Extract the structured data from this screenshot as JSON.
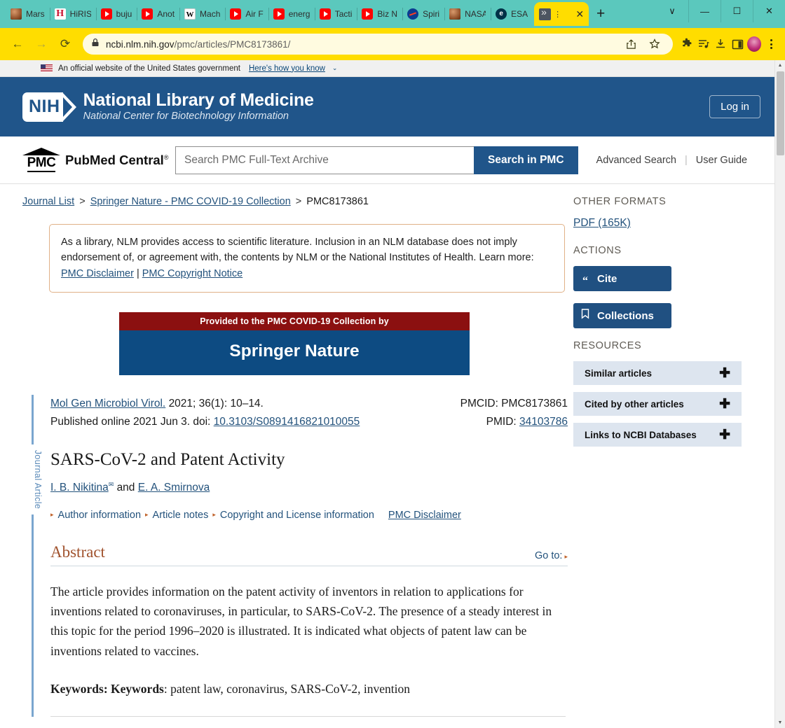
{
  "browser": {
    "bookmarks": [
      {
        "label": "Mars",
        "icon": "mars-favicon"
      },
      {
        "label": "HiRIS",
        "icon": "hirise-favicon"
      },
      {
        "label": "buju",
        "icon": "youtube-favicon"
      },
      {
        "label": "Anot",
        "icon": "youtube-favicon"
      },
      {
        "label": "Mach",
        "icon": "wikipedia-favicon"
      },
      {
        "label": "Air F",
        "icon": "youtube-favicon"
      },
      {
        "label": "energ",
        "icon": "youtube-favicon"
      },
      {
        "label": "Tacti",
        "icon": "youtube-favicon"
      },
      {
        "label": "Biz N",
        "icon": "youtube-favicon"
      },
      {
        "label": "Spiri",
        "icon": "nasa-favicon"
      },
      {
        "label": "NASA",
        "icon": "mars-favicon"
      },
      {
        "label": "ESA",
        "icon": "esa-favicon"
      }
    ],
    "tab": {
      "title": "",
      "menu_dots": "⋮",
      "close": "✕"
    },
    "new_tab_label": "+",
    "window_controls": {
      "dropdown": "∨",
      "minimize": "—",
      "maximize": "☐",
      "close": "✕"
    },
    "nav": {
      "back": "←",
      "forward": "→",
      "reload": "⟳"
    },
    "omnibox": {
      "url_domain": "ncbi.nlm.nih.gov",
      "url_path": "/pmc/articles/PMC8173861/",
      "lock": "lock-icon"
    },
    "toolbar_icons": [
      "share-icon",
      "star-icon",
      "extensions-icon",
      "reading-list-icon",
      "download-icon",
      "side-panel-icon",
      "profile-avatar",
      "chrome-menu-icon"
    ]
  },
  "gov_banner": {
    "text": "An official website of the United States government",
    "link": "Here's how you know",
    "chevron": "⌄"
  },
  "nih_header": {
    "badge": "NIH",
    "title": "National Library of Medicine",
    "subtitle": "National Center for Biotechnology Information",
    "login_label": "Log in"
  },
  "pmc_bar": {
    "logo_abbr": "PMC",
    "logo_name": "PubMed Central",
    "logo_reg": "®",
    "search_placeholder": "Search PMC Full-Text Archive",
    "search_value": "",
    "search_button": "Search in PMC",
    "advanced_search": "Advanced Search",
    "separator": "|",
    "user_guide": "User Guide"
  },
  "breadcrumb": {
    "journal_list": "Journal List",
    "sep1": ">",
    "collection": "Springer Nature - PMC COVID-19 Collection",
    "sep2": ">",
    "current": "PMC8173861"
  },
  "disclaimer": {
    "body": "As a library, NLM provides access to scientific literature. Inclusion in an NLM database does not imply endorsement of, or agreement with, the contents by NLM or the National Institutes of Health.",
    "learn_more": "Learn more:",
    "link1": "PMC Disclaimer",
    "pipe": "|",
    "link2": "PMC Copyright Notice"
  },
  "springer_banner": {
    "top_text": "Provided to the PMC COVID-19 Collection by",
    "publisher": "Springer Nature"
  },
  "article": {
    "rail_label": "Journal Article",
    "journal": "Mol Gen Microbiol Virol.",
    "citation": "2021; 36(1): 10–14.",
    "published": "Published online 2021 Jun 3. doi:",
    "doi": "10.3103/S0891416821010055",
    "pmcid_label": "PMCID:",
    "pmcid": "PMC8173861",
    "pmid_label": "PMID:",
    "pmid": "34103786",
    "title": "SARS-CoV-2 and Patent Activity",
    "author1": "I. B. Nikitina",
    "author_conj": "and",
    "author2": "E. A. Smirnova",
    "envelope_icon": "✉",
    "links": {
      "author_information": "Author information",
      "article_notes": "Article notes",
      "copyright": "Copyright and License information",
      "pmc_disclaimer": "PMC Disclaimer"
    },
    "abstract_heading": "Abstract",
    "goto_label": "Go to:",
    "abstract_text": "The article provides information on the patent activity of inventors in relation to applications for inventions related to coronaviruses, in particular, to SARS-CoV-2. The presence of a steady interest in this topic for the period 1996–2020 is illustrated. It is indicated what objects of patent law can be inventions related to vaccines.",
    "keywords_label": "Keywords:",
    "keywords_inner_label": "Keywords",
    "keywords_value": ": patent law, coronavirus, SARS-CoV-2, invention"
  },
  "sidebar": {
    "other_formats_heading": "OTHER FORMATS",
    "pdf_link": "PDF (165K)",
    "actions_heading": "ACTIONS",
    "cite_label": "Cite",
    "collections_label": "Collections",
    "resources_heading": "RESOURCES",
    "resources": [
      {
        "label": "Similar articles",
        "expand": "✚"
      },
      {
        "label": "Cited by other articles",
        "expand": "✚"
      },
      {
        "label": "Links to NCBI Databases",
        "expand": "✚"
      }
    ]
  },
  "colors": {
    "nih_blue": "#20558a",
    "accent_link": "#23527c",
    "springer_red": "#8b1010",
    "springer_blue": "#0d4b82",
    "abstract_brown": "#a0522d",
    "chrome_teal": "#5bc8bd",
    "chrome_yellow": "#ffdd00"
  }
}
